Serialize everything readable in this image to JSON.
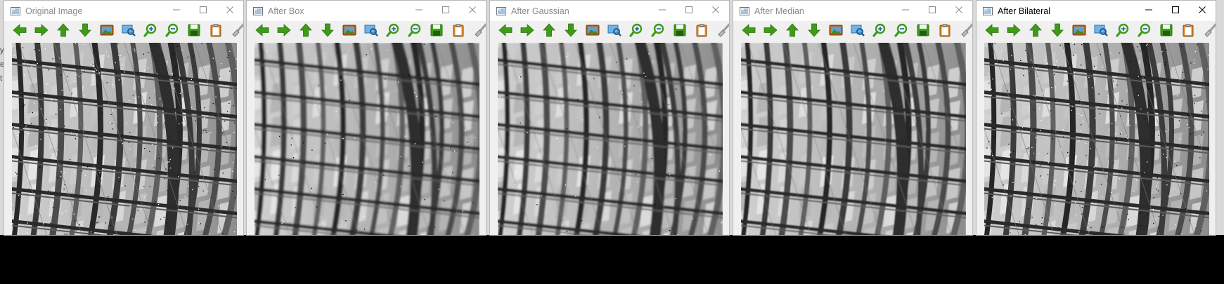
{
  "desktop": {
    "background_glyphs": [
      "y",
      "e",
      "t"
    ]
  },
  "windows": [
    {
      "title": "Original Image",
      "filter": "original",
      "active": false
    },
    {
      "title": "After Box",
      "filter": "box",
      "active": false
    },
    {
      "title": "After Gaussian",
      "filter": "gaussian",
      "active": false
    },
    {
      "title": "After Median",
      "filter": "median",
      "active": false
    },
    {
      "title": "After Bilateral",
      "filter": "bilateral",
      "active": true
    }
  ],
  "toolbar_icons": [
    "arrow-left-icon",
    "arrow-right-icon",
    "arrow-up-icon",
    "arrow-down-icon",
    "image-icon",
    "zoom-fit-icon",
    "zoom-in-icon",
    "zoom-out-icon",
    "save-icon",
    "clipboard-icon",
    "properties-brush-icon"
  ],
  "colors": {
    "toolbar_green": "#3f9b17",
    "titlebar_bg": "#ffffff",
    "inactive_title": "#8a8a8a",
    "canvas_bg": "#f0f0f0"
  }
}
